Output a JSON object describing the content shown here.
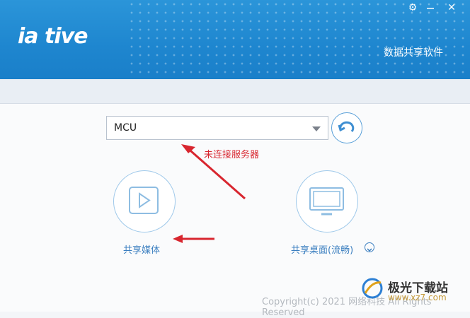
{
  "header": {
    "logo_text": "ia tive",
    "app_title": "数据共享软件",
    "settings_symbol": "⚙",
    "close_symbol": "✕"
  },
  "server_select": {
    "value": "MCU"
  },
  "status": {
    "text": "未连接服务器",
    "color": "#d8262f"
  },
  "actions": {
    "share_media": "共享媒体",
    "share_desktop": "共享桌面(流畅)"
  },
  "footer": {
    "copyright": "Copyright(c) 2021 网络科技 All Rights Reserved"
  },
  "watermark": {
    "site_name": "极光下载站",
    "url": "www.xz7.com"
  },
  "colors": {
    "header_blue": "#1e86cf",
    "accent_blue": "#3b7fc0",
    "annotation_red": "#d8262f"
  }
}
